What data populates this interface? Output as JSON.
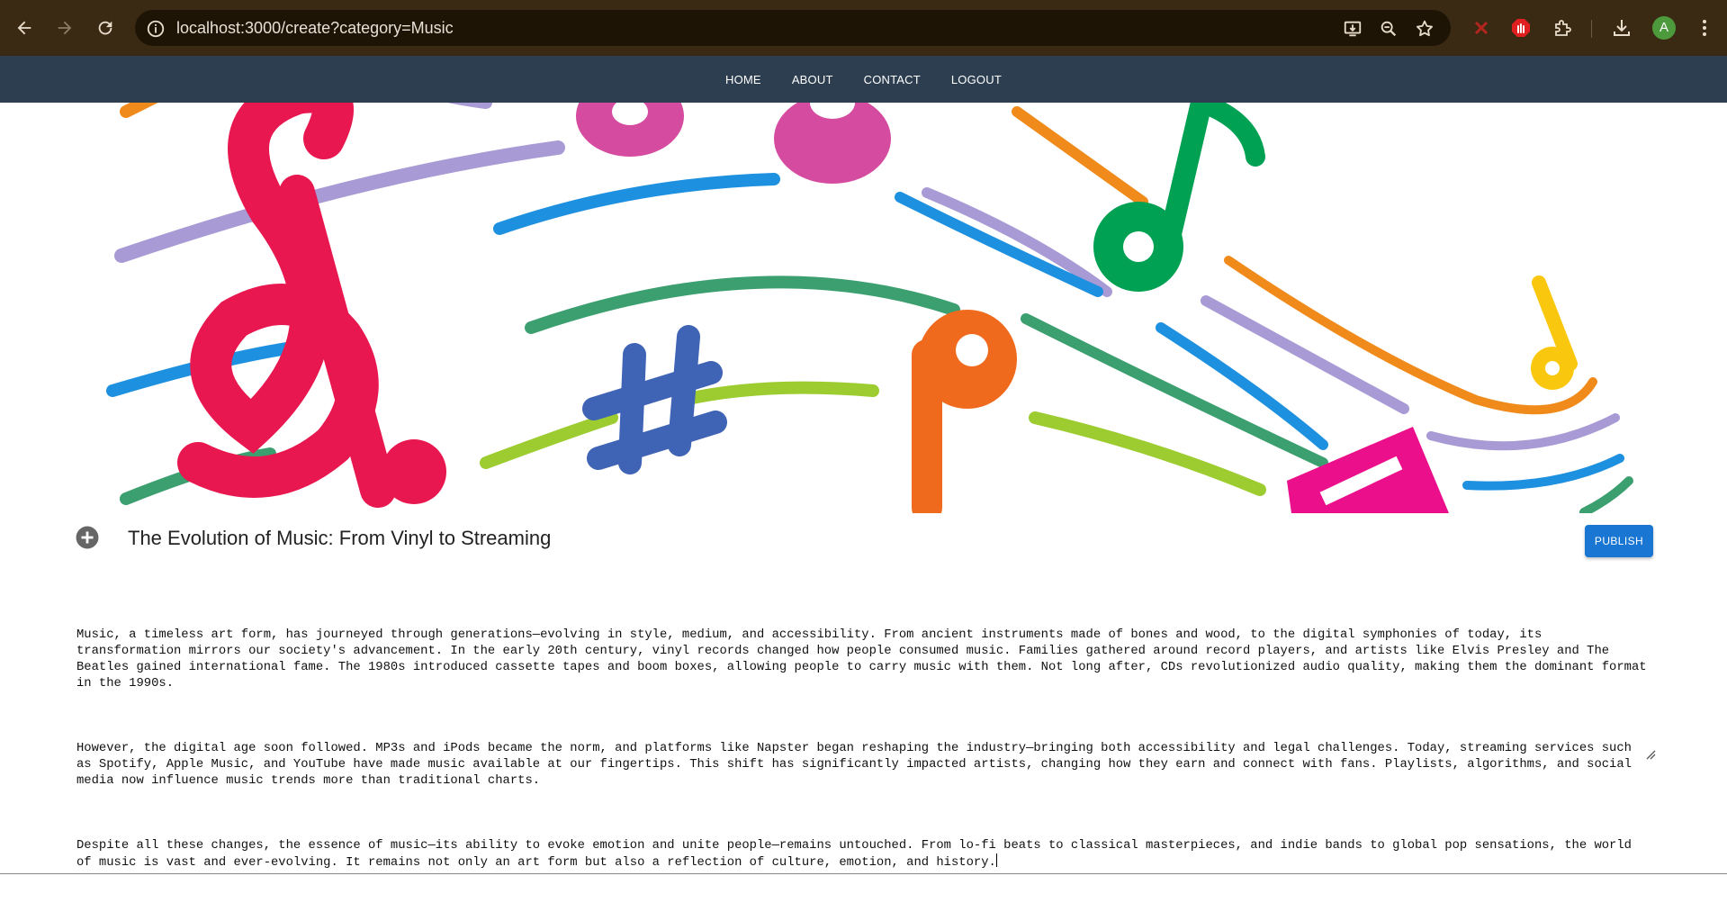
{
  "browser": {
    "url": "localhost:3000/create?category=Music",
    "profile_initial": "A"
  },
  "nav": {
    "links": [
      "HOME",
      "ABOUT",
      "CONTACT",
      "LOGOUT"
    ]
  },
  "editor": {
    "title": "The Evolution of Music: From Vinyl to Streaming",
    "publish_label": "PUBLISH",
    "paragraphs": [
      "Music, a timeless art form, has journeyed through generations—evolving in style, medium, and accessibility. From ancient instruments made of bones and wood, to the digital symphonies of today, its transformation mirrors our society's advancement. In the early 20th century, vinyl records changed how people consumed music. Families gathered around record players, and artists like Elvis Presley and The Beatles gained international fame. The 1980s introduced cassette tapes and boom boxes, allowing people to carry music with them. Not long after, CDs revolutionized audio quality, making them the dominant format in the 1990s.",
      "However, the digital age soon followed. MP3s and iPods became the norm, and platforms like Napster began reshaping the industry—bringing both accessibility and legal challenges. Today, streaming services such as Spotify, Apple Music, and YouTube have made music available at our fingertips. This shift has significantly impacted artists, changing how they earn and connect with fans. Playlists, algorithms, and social media now influence music trends more than traditional charts.",
      "Despite all these changes, the essence of music—its ability to evoke emotion and unite people—remains untouched. From lo-fi beats to classical masterpieces, and indie bands to global pop sensations, the world of music is vast and ever-evolving. It remains not only an art form but also a reflection of culture, emotion, and history."
    ]
  },
  "colors": {
    "browser_bar": "#3a2a14",
    "app_nav": "#2c3e50",
    "publish": "#1976d2"
  }
}
